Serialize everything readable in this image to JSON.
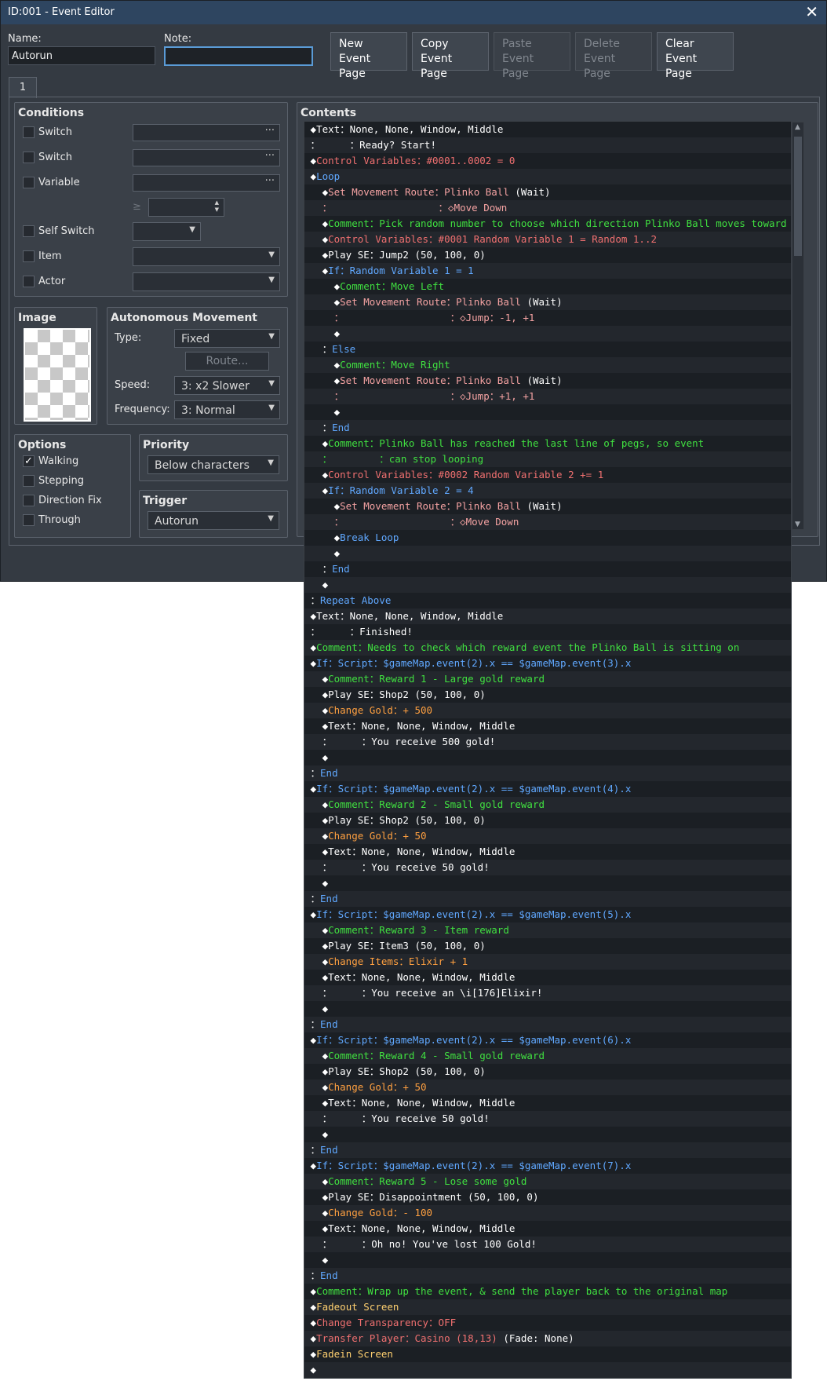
{
  "window": {
    "title": "ID:001 - Event Editor",
    "close": "✕"
  },
  "name": {
    "label": "Name:",
    "value": "Autorun"
  },
  "note": {
    "label": "Note:",
    "value": ""
  },
  "toolbar": [
    {
      "line1": "New",
      "line2": "Event Page",
      "enabled": true
    },
    {
      "line1": "Copy",
      "line2": "Event Page",
      "enabled": true
    },
    {
      "line1": "Paste",
      "line2": "Event Page",
      "enabled": false
    },
    {
      "line1": "Delete",
      "line2": "Event Page",
      "enabled": false
    },
    {
      "line1": "Clear",
      "line2": "Event Page",
      "enabled": true
    }
  ],
  "tabs": [
    "1"
  ],
  "conditions": {
    "title": "Conditions",
    "switch1": "Switch",
    "switch2": "Switch",
    "variable": "Variable",
    "gte": "≥",
    "self_switch": "Self Switch",
    "item": "Item",
    "actor": "Actor"
  },
  "image": {
    "title": "Image"
  },
  "movement": {
    "title": "Autonomous Movement",
    "type_label": "Type:",
    "type_value": "Fixed",
    "route": "Route...",
    "speed_label": "Speed:",
    "speed_value": "3: x2 Slower",
    "freq_label": "Frequency:",
    "freq_value": "3: Normal"
  },
  "options": {
    "title": "Options",
    "items": [
      {
        "label": "Walking",
        "checked": true
      },
      {
        "label": "Stepping",
        "checked": false
      },
      {
        "label": "Direction Fix",
        "checked": false
      },
      {
        "label": "Through",
        "checked": false
      }
    ]
  },
  "priority": {
    "title": "Priority",
    "value": "Below characters"
  },
  "trigger": {
    "title": "Trigger",
    "value": "Autorun"
  },
  "contents": {
    "title": "Contents",
    "colors": {
      "white": "#ffffff",
      "red": "#f07070",
      "salmon": "#f4a2a2",
      "green": "#40e040",
      "blue": "#60a8ff",
      "orange": "#ffa040",
      "gold": "#ffd070"
    },
    "lines": [
      [
        {
          "t": " ◆",
          "c": "white"
        },
        {
          "t": "Text",
          "c": "white"
        },
        {
          "t": "：None, None, Window, Middle",
          "c": "white"
        }
      ],
      [
        {
          "t": " ：     ：Ready? Start!",
          "c": "white"
        }
      ],
      [
        {
          "t": " ◆",
          "c": "white"
        },
        {
          "t": "Control Variables：#0001..0002 = 0",
          "c": "red"
        }
      ],
      [
        {
          "t": " ◆",
          "c": "white"
        },
        {
          "t": "Loop",
          "c": "blue"
        }
      ],
      [
        {
          "t": "   ◆",
          "c": "white"
        },
        {
          "t": "Set Movement Route：",
          "c": "salmon"
        },
        {
          "t": "Plinko Ball",
          "c": "salmon"
        },
        {
          "t": " (Wait)",
          "c": "white"
        }
      ],
      [
        {
          "t": "   ：                  ：◇Move Down",
          "c": "salmon"
        }
      ],
      [
        {
          "t": "   ◆",
          "c": "white"
        },
        {
          "t": "Comment：Pick random number to choose which direction Plinko Ball moves toward",
          "c": "green"
        }
      ],
      [
        {
          "t": "   ◆",
          "c": "white"
        },
        {
          "t": "Control Variables：#0001 Random Variable 1 = Random 1..2",
          "c": "red"
        }
      ],
      [
        {
          "t": "   ◆",
          "c": "white"
        },
        {
          "t": "Play SE：Jump2 (50, 100, 0)",
          "c": "white"
        }
      ],
      [
        {
          "t": "   ◆",
          "c": "white"
        },
        {
          "t": "If：Random Variable 1 = 1",
          "c": "blue"
        }
      ],
      [
        {
          "t": "     ◆",
          "c": "white"
        },
        {
          "t": "Comment：Move Left",
          "c": "green"
        }
      ],
      [
        {
          "t": "     ◆",
          "c": "white"
        },
        {
          "t": "Set Movement Route：",
          "c": "salmon"
        },
        {
          "t": "Plinko Ball",
          "c": "salmon"
        },
        {
          "t": " (Wait)",
          "c": "white"
        }
      ],
      [
        {
          "t": "     ：                  ：◇Jump：-1, +1",
          "c": "salmon"
        }
      ],
      [
        {
          "t": "     ◆",
          "c": "white"
        }
      ],
      [
        {
          "t": "   ：",
          "c": "white"
        },
        {
          "t": "Else",
          "c": "blue"
        }
      ],
      [
        {
          "t": "     ◆",
          "c": "white"
        },
        {
          "t": "Comment：Move Right",
          "c": "green"
        }
      ],
      [
        {
          "t": "     ◆",
          "c": "white"
        },
        {
          "t": "Set Movement Route：",
          "c": "salmon"
        },
        {
          "t": "Plinko Ball",
          "c": "salmon"
        },
        {
          "t": " (Wait)",
          "c": "white"
        }
      ],
      [
        {
          "t": "     ：                  ：◇Jump：+1, +1",
          "c": "salmon"
        }
      ],
      [
        {
          "t": "     ◆",
          "c": "white"
        }
      ],
      [
        {
          "t": "   ：",
          "c": "white"
        },
        {
          "t": "End",
          "c": "blue"
        }
      ],
      [
        {
          "t": "   ◆",
          "c": "white"
        },
        {
          "t": "Comment：Plinko Ball has reached the last line of pegs, so event",
          "c": "green"
        }
      ],
      [
        {
          "t": "   ：        ：can stop looping",
          "c": "green"
        }
      ],
      [
        {
          "t": "   ◆",
          "c": "white"
        },
        {
          "t": "Control Variables：#0002 Random Variable 2 += 1",
          "c": "red"
        }
      ],
      [
        {
          "t": "   ◆",
          "c": "white"
        },
        {
          "t": "If：Random Variable 2 = 4",
          "c": "blue"
        }
      ],
      [
        {
          "t": "     ◆",
          "c": "white"
        },
        {
          "t": "Set Movement Route：",
          "c": "salmon"
        },
        {
          "t": "Plinko Ball",
          "c": "salmon"
        },
        {
          "t": " (Wait)",
          "c": "white"
        }
      ],
      [
        {
          "t": "     ：                  ：◇Move Down",
          "c": "salmon"
        }
      ],
      [
        {
          "t": "     ◆",
          "c": "white"
        },
        {
          "t": "Break Loop",
          "c": "blue"
        }
      ],
      [
        {
          "t": "     ◆",
          "c": "white"
        }
      ],
      [
        {
          "t": "   ：",
          "c": "white"
        },
        {
          "t": "End",
          "c": "blue"
        }
      ],
      [
        {
          "t": "   ◆",
          "c": "white"
        }
      ],
      [
        {
          "t": " ：",
          "c": "white"
        },
        {
          "t": "Repeat Above",
          "c": "blue"
        }
      ],
      [
        {
          "t": " ◆",
          "c": "white"
        },
        {
          "t": "Text：None, None, Window, Middle",
          "c": "white"
        }
      ],
      [
        {
          "t": " ：     ：Finished!",
          "c": "white"
        }
      ],
      [
        {
          "t": " ◆",
          "c": "white"
        },
        {
          "t": "Comment：Needs to check which reward event the Plinko Ball is sitting on",
          "c": "green"
        }
      ],
      [
        {
          "t": " ◆",
          "c": "white"
        },
        {
          "t": "If：Script：$gameMap.event(2).x == $gameMap.event(3).x",
          "c": "blue"
        }
      ],
      [
        {
          "t": "   ◆",
          "c": "white"
        },
        {
          "t": "Comment：Reward 1 - Large gold reward",
          "c": "green"
        }
      ],
      [
        {
          "t": "   ◆",
          "c": "white"
        },
        {
          "t": "Play SE：Shop2 (50, 100, 0)",
          "c": "white"
        }
      ],
      [
        {
          "t": "   ◆",
          "c": "white"
        },
        {
          "t": "Change Gold：+ 500",
          "c": "orange"
        }
      ],
      [
        {
          "t": "   ◆",
          "c": "white"
        },
        {
          "t": "Text：None, None, Window, Middle",
          "c": "white"
        }
      ],
      [
        {
          "t": "   ：     ：You receive 500 gold!",
          "c": "white"
        }
      ],
      [
        {
          "t": "   ◆",
          "c": "white"
        }
      ],
      [
        {
          "t": " ：",
          "c": "white"
        },
        {
          "t": "End",
          "c": "blue"
        }
      ],
      [
        {
          "t": " ◆",
          "c": "white"
        },
        {
          "t": "If：Script：$gameMap.event(2).x == $gameMap.event(4).x",
          "c": "blue"
        }
      ],
      [
        {
          "t": "   ◆",
          "c": "white"
        },
        {
          "t": "Comment：Reward 2 - Small gold reward",
          "c": "green"
        }
      ],
      [
        {
          "t": "   ◆",
          "c": "white"
        },
        {
          "t": "Play SE：Shop2 (50, 100, 0)",
          "c": "white"
        }
      ],
      [
        {
          "t": "   ◆",
          "c": "white"
        },
        {
          "t": "Change Gold：+ 50",
          "c": "orange"
        }
      ],
      [
        {
          "t": "   ◆",
          "c": "white"
        },
        {
          "t": "Text：None, None, Window, Middle",
          "c": "white"
        }
      ],
      [
        {
          "t": "   ：     ：You receive 50 gold!",
          "c": "white"
        }
      ],
      [
        {
          "t": "   ◆",
          "c": "white"
        }
      ],
      [
        {
          "t": " ：",
          "c": "white"
        },
        {
          "t": "End",
          "c": "blue"
        }
      ],
      [
        {
          "t": " ◆",
          "c": "white"
        },
        {
          "t": "If：Script：$gameMap.event(2).x == $gameMap.event(5).x",
          "c": "blue"
        }
      ],
      [
        {
          "t": "   ◆",
          "c": "white"
        },
        {
          "t": "Comment：Reward 3 - Item reward",
          "c": "green"
        }
      ],
      [
        {
          "t": "   ◆",
          "c": "white"
        },
        {
          "t": "Play SE：Item3 (50, 100, 0)",
          "c": "white"
        }
      ],
      [
        {
          "t": "   ◆",
          "c": "white"
        },
        {
          "t": "Change Items：Elixir + 1",
          "c": "orange"
        }
      ],
      [
        {
          "t": "   ◆",
          "c": "white"
        },
        {
          "t": "Text：None, None, Window, Middle",
          "c": "white"
        }
      ],
      [
        {
          "t": "   ：     ：You receive an \\i[176]Elixir!",
          "c": "white"
        }
      ],
      [
        {
          "t": "   ◆",
          "c": "white"
        }
      ],
      [
        {
          "t": " ：",
          "c": "white"
        },
        {
          "t": "End",
          "c": "blue"
        }
      ],
      [
        {
          "t": " ◆",
          "c": "white"
        },
        {
          "t": "If：Script：$gameMap.event(2).x == $gameMap.event(6).x",
          "c": "blue"
        }
      ],
      [
        {
          "t": "   ◆",
          "c": "white"
        },
        {
          "t": "Comment：Reward 4 - Small gold reward",
          "c": "green"
        }
      ],
      [
        {
          "t": "   ◆",
          "c": "white"
        },
        {
          "t": "Play SE：Shop2 (50, 100, 0)",
          "c": "white"
        }
      ],
      [
        {
          "t": "   ◆",
          "c": "white"
        },
        {
          "t": "Change Gold：+ 50",
          "c": "orange"
        }
      ],
      [
        {
          "t": "   ◆",
          "c": "white"
        },
        {
          "t": "Text：None, None, Window, Middle",
          "c": "white"
        }
      ],
      [
        {
          "t": "   ：     ：You receive 50 gold!",
          "c": "white"
        }
      ],
      [
        {
          "t": "   ◆",
          "c": "white"
        }
      ],
      [
        {
          "t": " ：",
          "c": "white"
        },
        {
          "t": "End",
          "c": "blue"
        }
      ],
      [
        {
          "t": " ◆",
          "c": "white"
        },
        {
          "t": "If：Script：$gameMap.event(2).x == $gameMap.event(7).x",
          "c": "blue"
        }
      ],
      [
        {
          "t": "   ◆",
          "c": "white"
        },
        {
          "t": "Comment：Reward 5 - Lose some gold",
          "c": "green"
        }
      ],
      [
        {
          "t": "   ◆",
          "c": "white"
        },
        {
          "t": "Play SE：Disappointment (50, 100, 0)",
          "c": "white"
        }
      ],
      [
        {
          "t": "   ◆",
          "c": "white"
        },
        {
          "t": "Change Gold：- 100",
          "c": "orange"
        }
      ],
      [
        {
          "t": "   ◆",
          "c": "white"
        },
        {
          "t": "Text：None, None, Window, Middle",
          "c": "white"
        }
      ],
      [
        {
          "t": "   ：     ：Oh no! You've lost 100 Gold!",
          "c": "white"
        }
      ],
      [
        {
          "t": "   ◆",
          "c": "white"
        }
      ],
      [
        {
          "t": " ：",
          "c": "white"
        },
        {
          "t": "End",
          "c": "blue"
        }
      ],
      [
        {
          "t": " ◆",
          "c": "white"
        },
        {
          "t": "Comment：Wrap up the event, & send the player back to the original map",
          "c": "green"
        }
      ],
      [
        {
          "t": " ◆",
          "c": "white"
        },
        {
          "t": "Fadeout Screen",
          "c": "gold"
        }
      ],
      [
        {
          "t": " ◆",
          "c": "white"
        },
        {
          "t": "Change Transparency：OFF",
          "c": "red"
        }
      ],
      [
        {
          "t": " ◆",
          "c": "white"
        },
        {
          "t": "Transfer Player：Casino (18,13)",
          "c": "red"
        },
        {
          "t": " (Fade: None)",
          "c": "white"
        }
      ],
      [
        {
          "t": " ◆",
          "c": "white"
        },
        {
          "t": "Fadein Screen",
          "c": "gold"
        }
      ],
      [
        {
          "t": " ◆",
          "c": "white"
        }
      ]
    ]
  }
}
